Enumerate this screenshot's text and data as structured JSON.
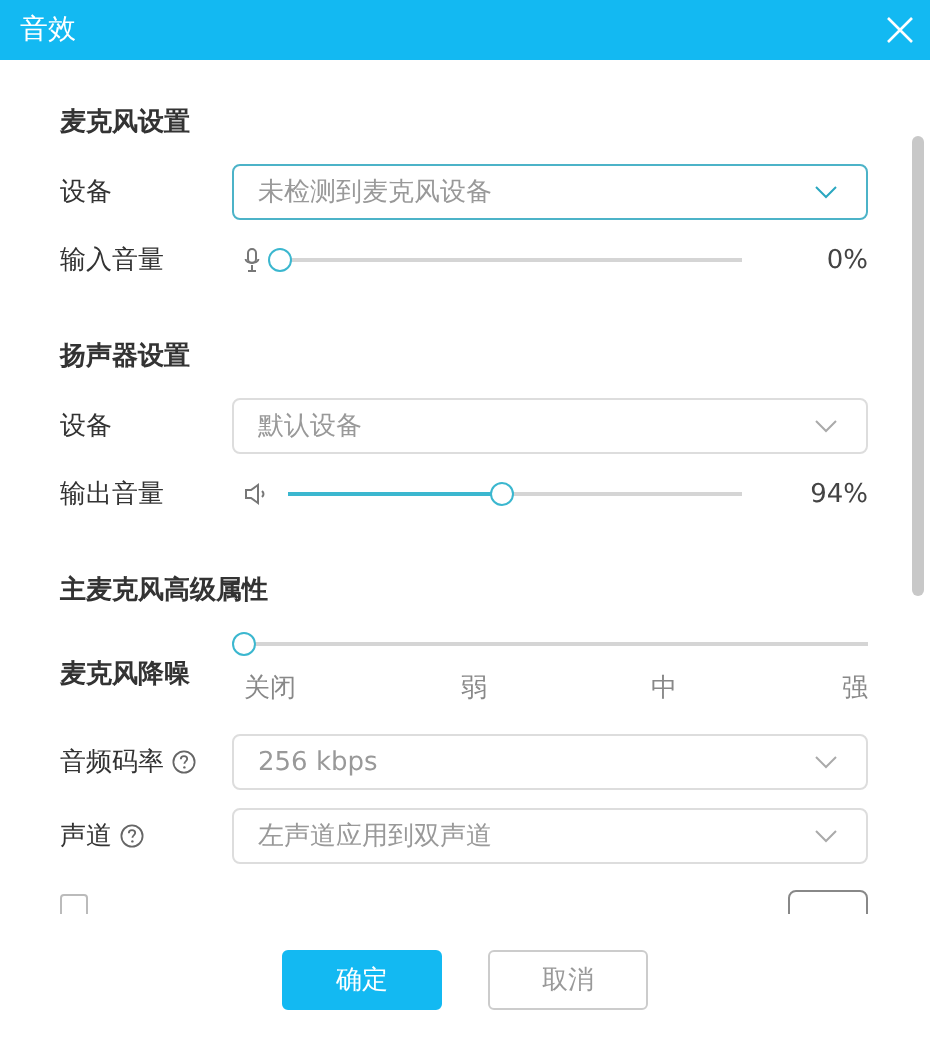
{
  "window": {
    "title": "音效"
  },
  "sections": [
    {
      "title": "麦克风设置",
      "rows": [
        {
          "kind": "select",
          "label": "设备",
          "value": "未检测到麦克风设备",
          "focused": true,
          "help": false
        },
        {
          "kind": "mic_volume",
          "label": "输入音量",
          "level": 0,
          "reading": "0%"
        }
      ]
    },
    {
      "title": "扬声器设置",
      "rows": [
        {
          "kind": "select",
          "label": "设备",
          "value": "默认设备",
          "focused": false,
          "help": false
        },
        {
          "kind": "speaker_volume",
          "label": "输出音量",
          "level": 0.47,
          "reading": "94%"
        }
      ]
    },
    {
      "title": "主麦克风高级属性",
      "rows": [
        {
          "kind": "steps",
          "label": "麦克风降噪",
          "level": 0,
          "steps": [
            "关闭",
            "弱",
            "中",
            "强"
          ]
        },
        {
          "kind": "select",
          "label": "音频码率",
          "value": "256 kbps",
          "focused": false,
          "help": true
        },
        {
          "kind": "select",
          "label": "声道",
          "value": "左声道应用到双声道",
          "focused": false,
          "help": true
        },
        {
          "kind": "checkbox",
          "checked": false
        }
      ]
    }
  ],
  "buttons": [
    {
      "label": "确定",
      "primary": true
    },
    {
      "label": "取消",
      "primary": false
    }
  ]
}
